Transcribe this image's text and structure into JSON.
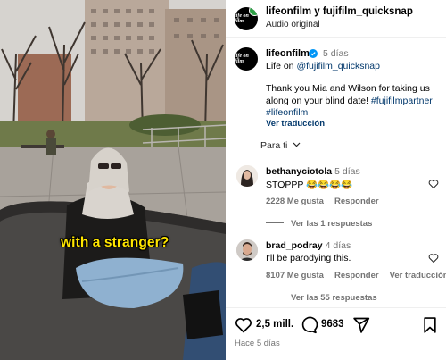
{
  "media": {
    "overlay_caption": "with a stranger?"
  },
  "header": {
    "title": "lifeonfilm y fujifilm_quicksnap",
    "subtitle": "Audio original",
    "avatar_logo_text": "life on film"
  },
  "caption": {
    "username": "lifeonfilm",
    "time": "5 días",
    "line1_prefix": "Life on ",
    "line1_mention": "@fujifilm_quicksnap",
    "body": "Thank you Mia and Wilson for taking us along on your blind date! ",
    "body_tag1": "#fujifilmpartner",
    "body_tag2": "#lifeonfilm",
    "translate": "Ver traducción"
  },
  "for_you": {
    "label": "Para ti"
  },
  "comments": [
    {
      "username": "bethanyciotola",
      "time": "5 días",
      "text": "STOPPP 😂😂😂😂",
      "likes": "2228 Me gusta",
      "reply": "Responder",
      "replies": "Ver las 1 respuestas"
    },
    {
      "username": "brad_podray",
      "time": "4 días",
      "text": "I'll be parodying this.",
      "likes": "8107 Me gusta",
      "reply": "Responder",
      "translate": "Ver traducción",
      "replies": "Ver las 55 respuestas"
    }
  ],
  "actions": {
    "likes": "2,5 mill.",
    "comments": "9683",
    "date": "Hace 5 días"
  },
  "colors": {
    "link": "#00376b",
    "muted": "#737373",
    "caption_yellow": "#ffe600"
  }
}
